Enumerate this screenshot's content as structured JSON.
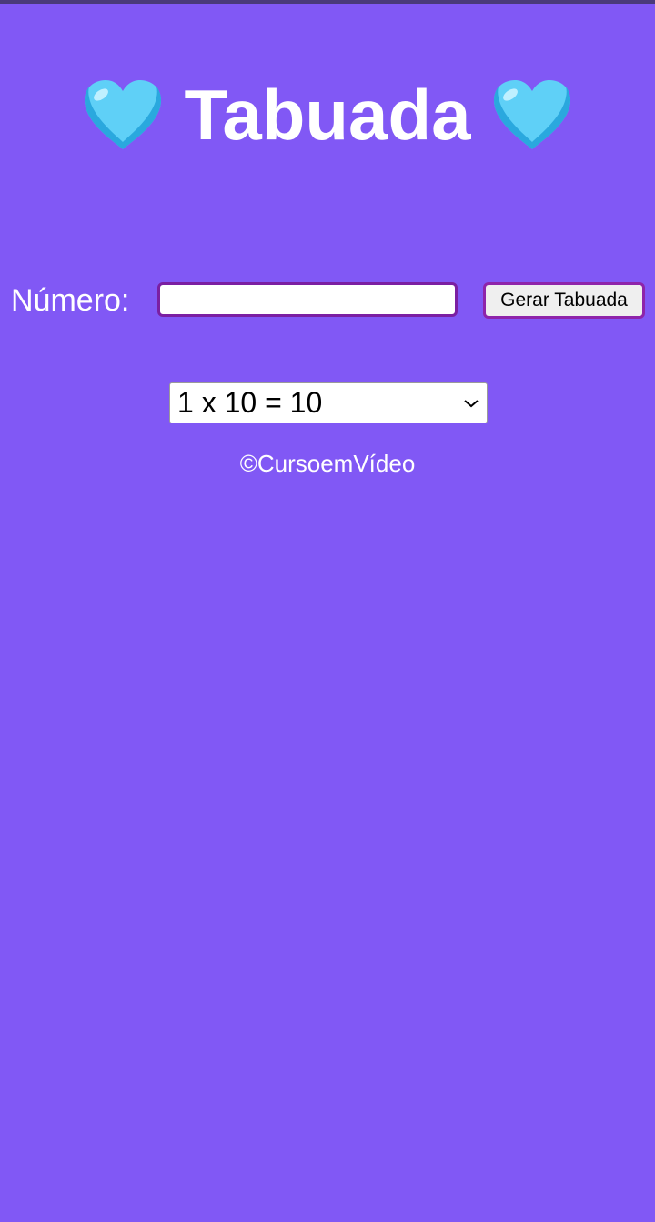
{
  "page": {
    "background_color": "#8158f5",
    "title": "Tabuada",
    "title_icon": "light-blue-heart-icon",
    "title_icon_color": "#5fd0f7"
  },
  "form": {
    "numero_label": "Número:",
    "numero_value": "",
    "numero_placeholder": "",
    "generate_button_label": "Gerar Tabuada"
  },
  "result": {
    "selected_option": "1 x 10 = 10",
    "dropdown_icon": "chevron-down-icon"
  },
  "footer": {
    "credit": "©CursoemVídeo"
  }
}
